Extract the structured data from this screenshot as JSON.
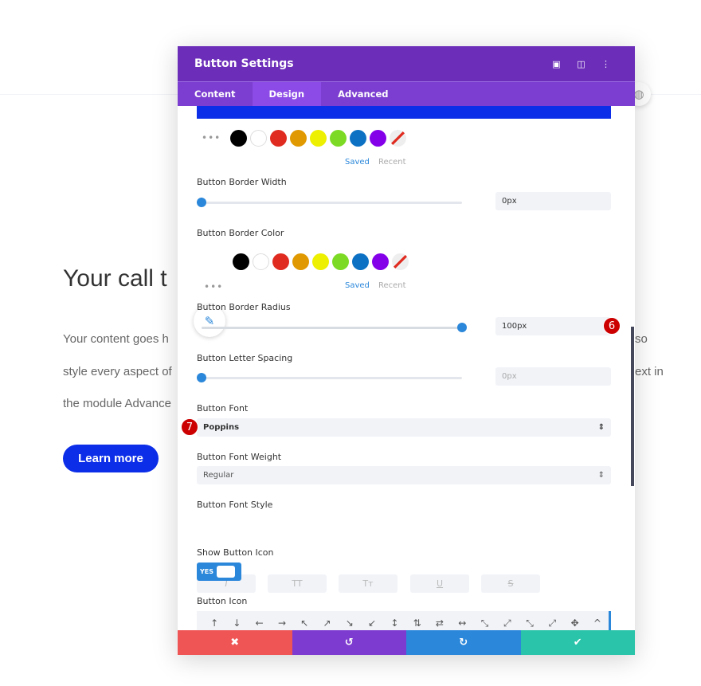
{
  "background": {
    "heading": "Your call t",
    "para_lines": [
      "Your content goes h",
      "style every aspect of",
      "the module Advance"
    ],
    "para_right": [
      "so",
      "ext in"
    ],
    "button_label": "Learn more"
  },
  "modal": {
    "title": "Button Settings",
    "tabs": [
      {
        "label": "Content"
      },
      {
        "label": "Design"
      },
      {
        "label": "Advanced"
      }
    ],
    "active_tab": "Design",
    "swatch_colors": [
      "#000000",
      "#ffffff",
      "#e02b20",
      "#e09900",
      "#edf000",
      "#7cda24",
      "#0c71c3",
      "#8300e9"
    ],
    "selected_color": "#0c2ee8",
    "saved": "Saved",
    "recent": "Recent",
    "border_width": {
      "label": "Button Border Width",
      "value": "0px",
      "slider_percent": 0
    },
    "border_color": {
      "label": "Button Border Color"
    },
    "border_radius": {
      "label": "Button Border Radius",
      "value": "100px",
      "slider_percent": 100,
      "badge": "6"
    },
    "letter_spacing": {
      "label": "Button Letter Spacing",
      "value": "0px",
      "slider_percent": 0
    },
    "font": {
      "label": "Button Font",
      "value": "Poppins",
      "badge": "7"
    },
    "font_weight": {
      "label": "Button Font Weight",
      "value": "Regular"
    },
    "font_style": {
      "label": "Button Font Style",
      "options": [
        "I",
        "TT",
        "Tт",
        "U",
        "S"
      ]
    },
    "show_icon": {
      "label": "Show Button Icon",
      "value": "YES"
    },
    "button_icon": {
      "label": "Button Icon",
      "icons": [
        "↑",
        "↓",
        "←",
        "→",
        "↖",
        "↗",
        "↘",
        "↙",
        "↕",
        "⇅",
        "⇄",
        "↔",
        "⤡",
        "⤢",
        "⤡",
        "⤢",
        "✥",
        "^"
      ]
    },
    "footer": {
      "cancel": "✖",
      "undo": "↺",
      "redo": "↻",
      "save": "✔"
    }
  }
}
